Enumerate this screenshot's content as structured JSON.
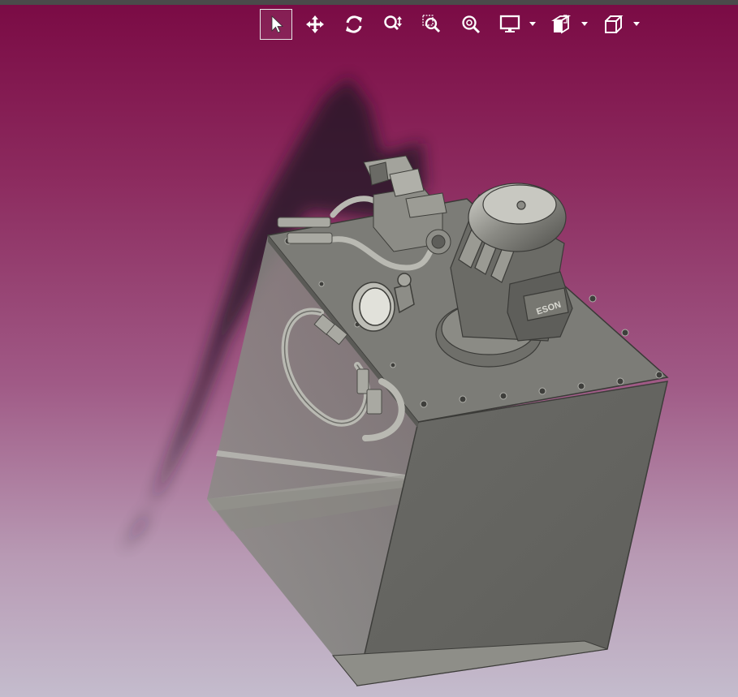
{
  "toolbar": {
    "tools": [
      {
        "id": "select",
        "icon": "arrow-cursor-icon",
        "active": true
      },
      {
        "id": "pan",
        "icon": "move-icon",
        "active": false
      },
      {
        "id": "rotate",
        "icon": "rotate-icon",
        "active": false
      },
      {
        "id": "zoom-dynamic",
        "icon": "zoom-updown-icon",
        "active": false
      },
      {
        "id": "zoom-window",
        "icon": "zoom-window-icon",
        "active": false
      },
      {
        "id": "zoom-fit",
        "icon": "zoom-fit-icon",
        "active": false
      },
      {
        "id": "display-mode",
        "icon": "monitor-icon",
        "has_dropdown": true
      },
      {
        "id": "section-view",
        "icon": "section-view-icon",
        "has_dropdown": true
      },
      {
        "id": "view-orientation",
        "icon": "cube-icon",
        "has_dropdown": true
      }
    ]
  },
  "colors": {
    "background_top": "#7a0a44",
    "background_bottom": "#c4bccd",
    "model_gray": "#6e6e6a",
    "toolbar_icon": "#ffffff"
  },
  "scene": {
    "model_name": "",
    "motor_label": "ESON"
  }
}
